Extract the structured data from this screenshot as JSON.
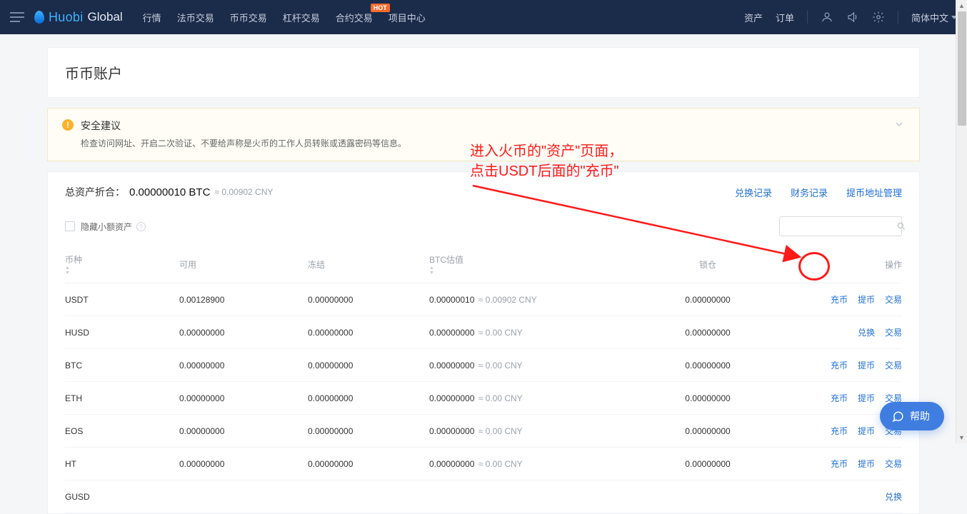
{
  "brand": {
    "name1": "Huobi",
    "name2": "Global"
  },
  "nav": [
    "行情",
    "法币交易",
    "币币交易",
    "杠杆交易",
    "合约交易",
    "项目中心"
  ],
  "nav_hot_index": 4,
  "nav_hot_label": "HOT",
  "right_nav": {
    "assets": "资产",
    "orders": "订单",
    "lang": "简体中文"
  },
  "page_title": "币币账户",
  "warning": {
    "title": "安全建议",
    "desc": "检查访问网址、开启二次验证、不要给声称是火币的工作人员转账或透露密码等信息。"
  },
  "total": {
    "label": "总资产折合：",
    "btc": "0.00000010 BTC",
    "cny": "≈ 0.00902 CNY"
  },
  "panel_links": [
    "兑换记录",
    "财务记录",
    "提币地址管理"
  ],
  "hide_small": "隐藏小额资产",
  "columns": {
    "coin": "币种",
    "avail": "可用",
    "frozen": "冻结",
    "btc": "BTC估值",
    "lock": "锁仓",
    "op": "操作"
  },
  "rows": [
    {
      "coin": "USDT",
      "avail": "0.00128900",
      "frozen": "0.00000000",
      "btc": "0.00000010",
      "approx": "≈ 0.00902 CNY",
      "lock": "0.00000000",
      "ops": [
        "充币",
        "提币",
        "交易"
      ]
    },
    {
      "coin": "HUSD",
      "avail": "0.00000000",
      "frozen": "0.00000000",
      "btc": "0.00000000",
      "approx": "≈ 0.00 CNY",
      "lock": "0.00000000",
      "ops": [
        "兑换",
        "交易"
      ]
    },
    {
      "coin": "BTC",
      "avail": "0.00000000",
      "frozen": "0.00000000",
      "btc": "0.00000000",
      "approx": "≈ 0.00 CNY",
      "lock": "0.00000000",
      "ops": [
        "充币",
        "提币",
        "交易"
      ]
    },
    {
      "coin": "ETH",
      "avail": "0.00000000",
      "frozen": "0.00000000",
      "btc": "0.00000000",
      "approx": "≈ 0.00 CNY",
      "lock": "0.00000000",
      "ops": [
        "充币",
        "提币",
        "交易"
      ]
    },
    {
      "coin": "EOS",
      "avail": "0.00000000",
      "frozen": "0.00000000",
      "btc": "0.00000000",
      "approx": "≈ 0.00 CNY",
      "lock": "0.00000000",
      "ops": [
        "充币",
        "提币",
        "交易"
      ]
    },
    {
      "coin": "HT",
      "avail": "0.00000000",
      "frozen": "0.00000000",
      "btc": "0.00000000",
      "approx": "≈ 0.00 CNY",
      "lock": "0.00000000",
      "ops": [
        "充币",
        "提币",
        "交易"
      ]
    },
    {
      "coin": "GUSD",
      "avail": "",
      "frozen": "",
      "btc": "",
      "approx": "",
      "lock": "",
      "ops": [
        "兑换"
      ]
    }
  ],
  "annotation": {
    "line1": "进入火币的\"资产\"页面，",
    "line2": "点击USDT后面的\"充币\""
  },
  "help": "帮助"
}
